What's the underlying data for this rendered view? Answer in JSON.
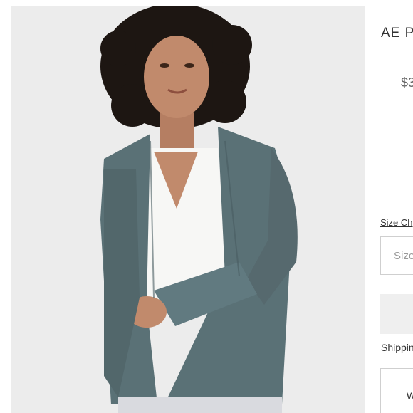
{
  "product": {
    "title": "AE P",
    "price_original": "$3"
  },
  "controls": {
    "size_chart_label": "Size Ch",
    "size_placeholder": "Size",
    "shipping_label": "Shippin",
    "wishlist_label": "W"
  },
  "image": {
    "subject": "model-wearing-cardigan",
    "colors": {
      "background": "#ececec",
      "cardigan": "#5a7176",
      "tshirt": "#f7f7f5",
      "skin": "#c18a6c",
      "hair": "#1d1612"
    }
  }
}
